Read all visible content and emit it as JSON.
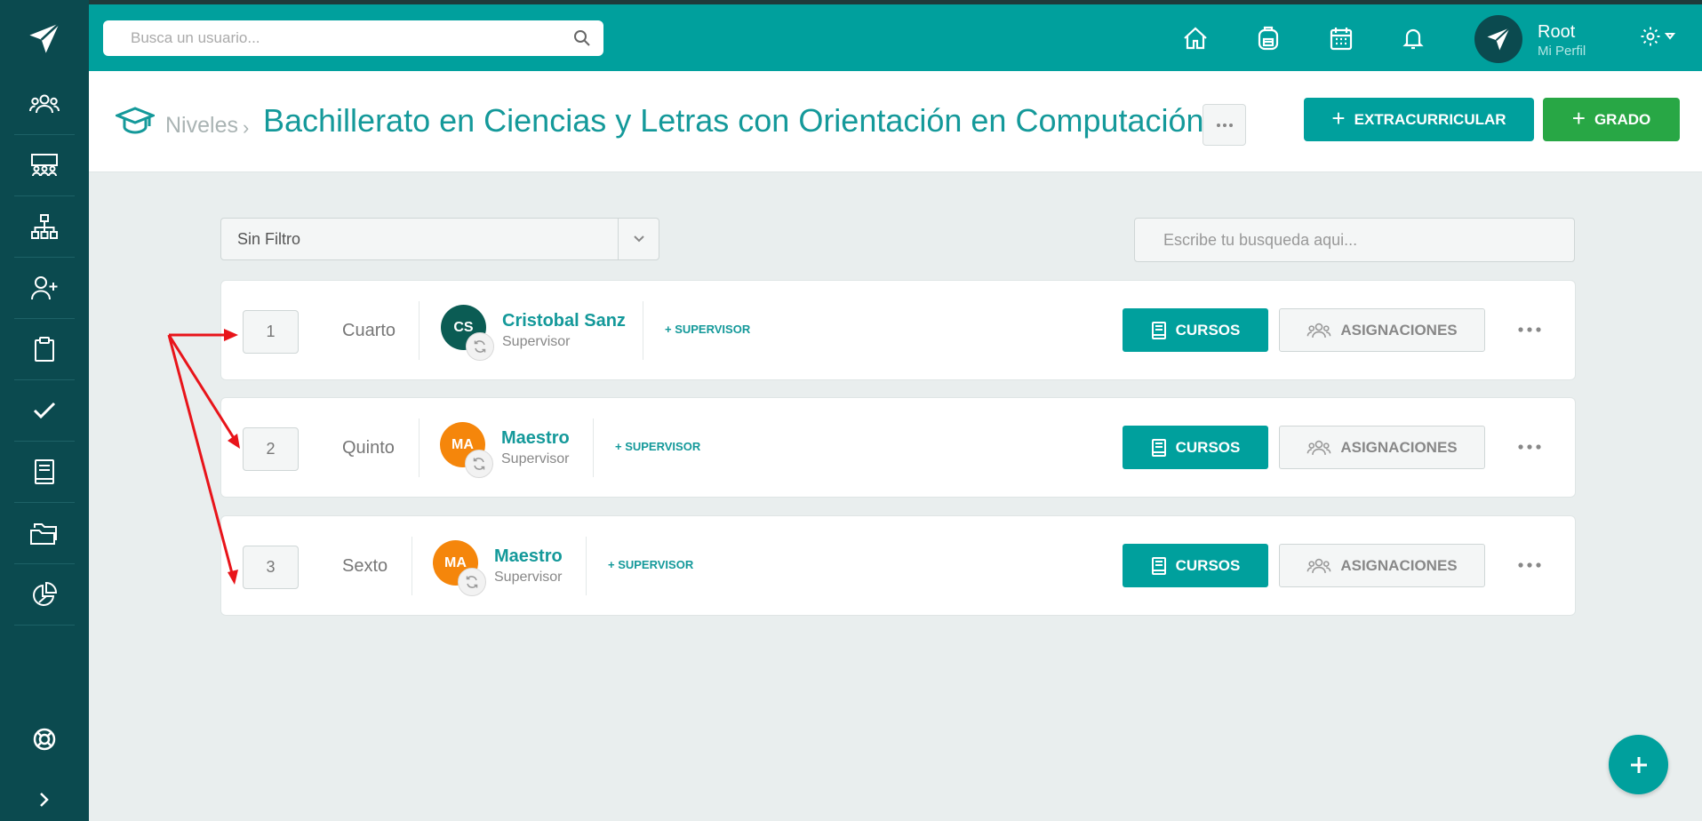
{
  "header": {
    "search_placeholder": "Busca un usuario...",
    "user_name": "Root",
    "user_link": "Mi Perfil"
  },
  "breadcrumb": {
    "parent": "Niveles",
    "separator": "›",
    "current": "Bachillerato en Ciencias y Letras con Orientación en Computación"
  },
  "actions": {
    "extracurricular_label": "EXTRACURRICULAR",
    "grado_label": "GRADO",
    "plus": "+"
  },
  "filter": {
    "selected": "Sin Filtro",
    "search_placeholder": "Escribe tu busqueda aqui..."
  },
  "grades": [
    {
      "number": "1",
      "name": "Cuarto",
      "avatar_initials": "CS",
      "supervisor_name": "Cristobal Sanz",
      "supervisor_role": "Supervisor",
      "add_supervisor": "+ SUPERVISOR",
      "cursos_label": "CURSOS",
      "asignaciones_label": "ASIGNACIONES"
    },
    {
      "number": "2",
      "name": "Quinto",
      "avatar_initials": "MA",
      "supervisor_name": "Maestro",
      "supervisor_role": "Supervisor",
      "add_supervisor": "+ SUPERVISOR",
      "cursos_label": "CURSOS",
      "asignaciones_label": "ASIGNACIONES"
    },
    {
      "number": "3",
      "name": "Sexto",
      "avatar_initials": "MA",
      "supervisor_name": "Maestro",
      "supervisor_role": "Supervisor",
      "add_supervisor": "+ SUPERVISOR",
      "cursos_label": "CURSOS",
      "asignaciones_label": "ASIGNACIONES"
    }
  ],
  "colors": {
    "primary": "#00a09d",
    "sidebar": "#0b4a4f",
    "success": "#28a745",
    "avatar_orange": "#f5860b",
    "annotation_arrow": "#e8141a"
  },
  "icons": {
    "sidebar": [
      "users-icon",
      "classroom-icon",
      "org-chart-icon",
      "add-user-icon",
      "clipboard-icon",
      "check-icon",
      "book-icon",
      "folders-icon",
      "pie-chart-icon"
    ],
    "sidebar_bottom": [
      "lifebuoy-icon",
      "expand-chevron-icon"
    ],
    "header": [
      "home-icon",
      "backpack-icon",
      "calendar-icon",
      "bell-icon",
      "gear-icon"
    ]
  }
}
